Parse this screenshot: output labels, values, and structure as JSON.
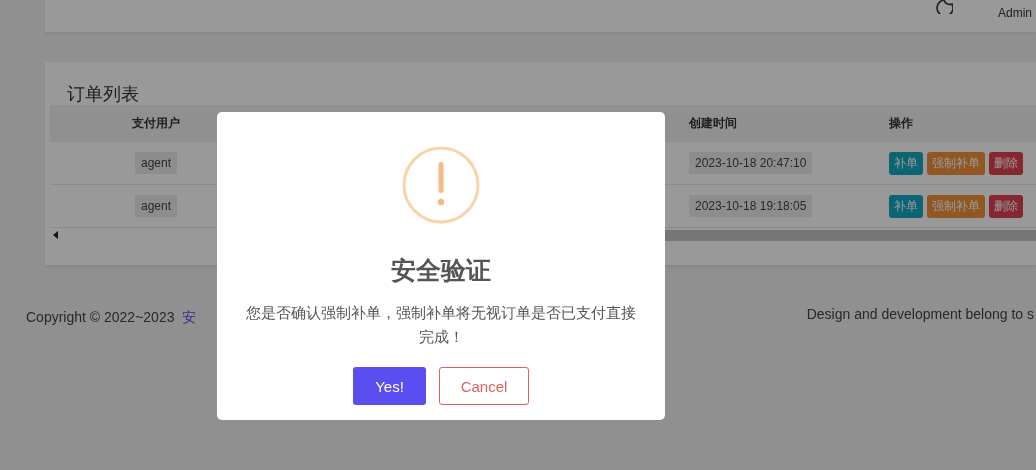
{
  "header": {
    "user": "Admin"
  },
  "orders": {
    "title": "订单列表",
    "columns": [
      "支付用户",
      "创建时间",
      "操作"
    ],
    "rows": [
      {
        "user": "agent",
        "created": "2023-10-18 20:47:10",
        "actions": [
          {
            "label": "补单",
            "kind": "primary"
          },
          {
            "label": "强制补单",
            "kind": "warning"
          },
          {
            "label": "删除",
            "kind": "danger"
          }
        ]
      },
      {
        "user": "agent",
        "created": "2023-10-18 19:18:05",
        "actions": [
          {
            "label": "补单",
            "kind": "primary"
          },
          {
            "label": "强制补单",
            "kind": "warning"
          },
          {
            "label": "删除",
            "kind": "danger"
          }
        ]
      }
    ]
  },
  "footer": {
    "copyright": "Copyright © 2022~2023",
    "link": "安",
    "credit": "Design and development belong to s"
  },
  "dialog": {
    "title": "安全验证",
    "message": "您是否确认强制补单，强制补单将无视订单是否已支付直接完成！",
    "buttons": [
      {
        "label": "Yes!",
        "kind": "confirm"
      },
      {
        "label": "Cancel",
        "kind": "cancel"
      }
    ]
  }
}
